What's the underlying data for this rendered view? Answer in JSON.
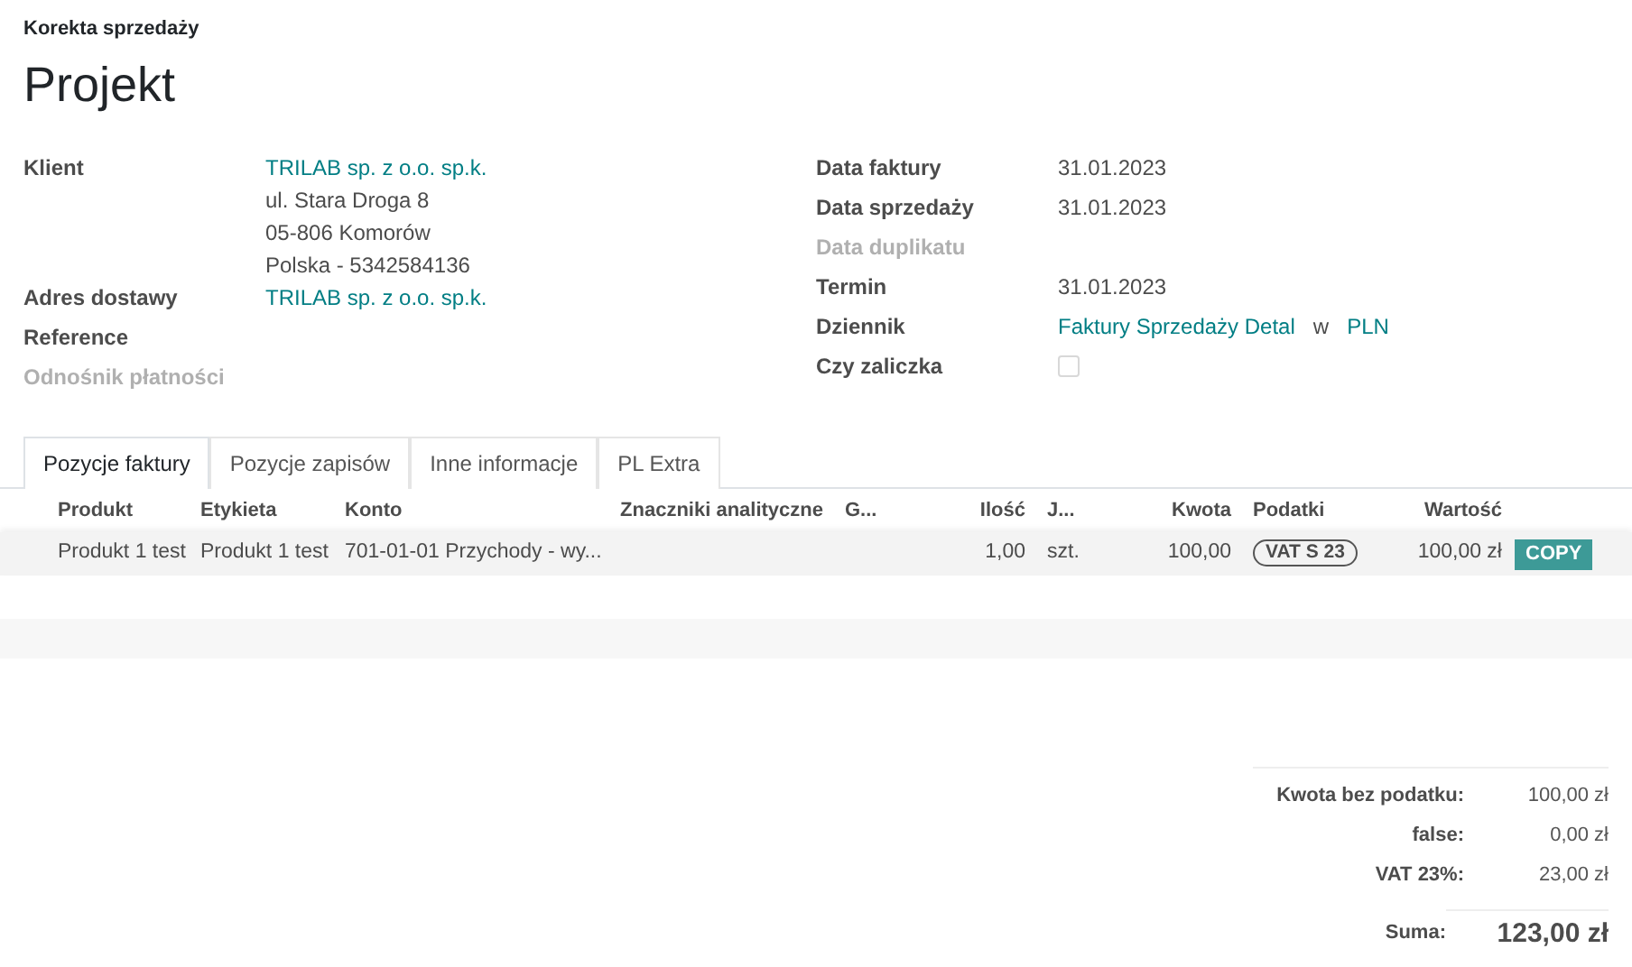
{
  "breadcrumb": "Korekta sprzedaży",
  "title": "Projekt",
  "left_fields": [
    {
      "label": "Klient",
      "disabled": false,
      "values": [
        {
          "kind": "link",
          "text": "TRILAB sp. z o.o. sp.k."
        },
        {
          "kind": "text",
          "text": "ul. Stara Droga 8"
        },
        {
          "kind": "text",
          "text": "05-806 Komorów"
        },
        {
          "kind": "text",
          "text": "Polska - 5342584136"
        }
      ]
    },
    {
      "label": "Adres dostawy",
      "disabled": false,
      "values": [
        {
          "kind": "link",
          "text": "TRILAB sp. z o.o. sp.k."
        }
      ]
    },
    {
      "label": "Reference",
      "disabled": false
    },
    {
      "label": "Odnośnik płatności",
      "disabled": true
    }
  ],
  "right_fields": [
    {
      "label": "Data faktury",
      "disabled": false,
      "values": [
        {
          "kind": "text",
          "text": "31.01.2023"
        }
      ]
    },
    {
      "label": "Data sprzedaży",
      "disabled": false,
      "values": [
        {
          "kind": "text",
          "text": "31.01.2023"
        }
      ]
    },
    {
      "label": "Data duplikatu",
      "disabled": true
    },
    {
      "label": "Termin",
      "disabled": false,
      "values": [
        {
          "kind": "text",
          "text": "31.01.2023"
        }
      ]
    },
    {
      "label": "Dziennik",
      "disabled": false,
      "values": [
        {
          "kind": "link",
          "text": "Faktury Sprzedaży Detal"
        },
        {
          "kind": "text",
          "text": "w"
        },
        {
          "kind": "link",
          "text": "PLN"
        }
      ]
    },
    {
      "label": "Czy zaliczka",
      "disabled": false,
      "values": [
        {
          "kind": "checkbox",
          "checked": false
        }
      ]
    }
  ],
  "tabs": [
    {
      "label": "Pozycje faktury",
      "selected": true
    },
    {
      "label": "Pozycje zapisów",
      "selected": false
    },
    {
      "label": "Inne informacje",
      "selected": false
    },
    {
      "label": "PL Extra",
      "selected": false
    }
  ],
  "table": {
    "columns": [
      "Produkt",
      "Etykieta",
      "Konto",
      "Znaczniki analityczne",
      "G...",
      "Ilość",
      "J...",
      "Kwota",
      "Podatki",
      "Wartość"
    ],
    "rows": [
      {
        "cells": [
          "Produkt 1 test",
          "Produkt 1 test",
          "701-01-01 Przychody - wy...",
          "",
          "",
          "1,00",
          "szt.",
          "100,00",
          "VAT S 23",
          "100,00 zł"
        ],
        "action": "COPY"
      }
    ]
  },
  "totals": [
    {
      "label": "Kwota bez podatku:",
      "value": "100,00 zł"
    },
    {
      "label": "false:",
      "value": "0,00 zł"
    },
    {
      "label": "VAT 23%:",
      "value": "23,00 zł"
    }
  ],
  "total": {
    "label": "Suma:",
    "value": "123,00 zł"
  }
}
